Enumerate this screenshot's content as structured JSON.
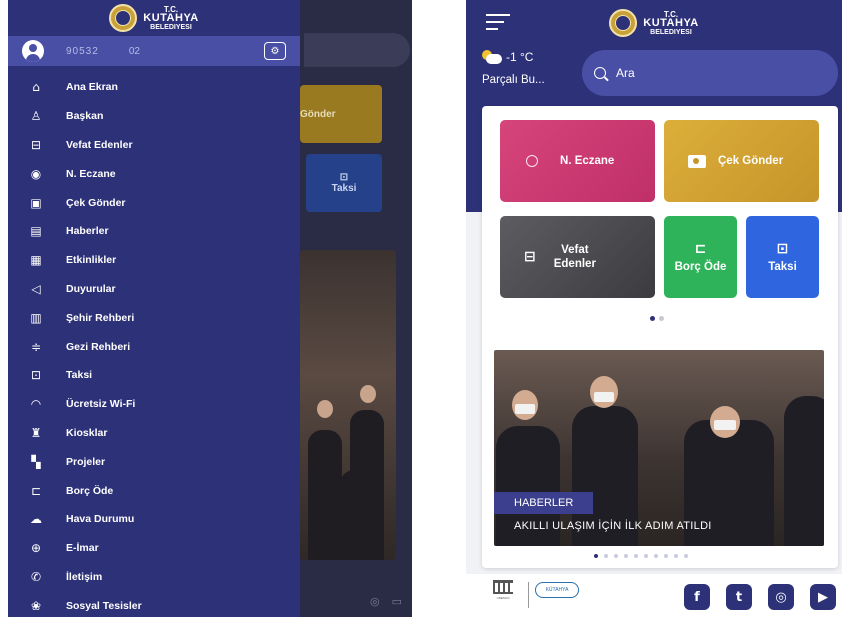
{
  "left_screen": {
    "logo": {
      "tc": "T.C.",
      "name": "KUTAHYA",
      "sub": "BELEDIYESI"
    },
    "user": {
      "phone": "90532",
      "ext": "02"
    },
    "background": {
      "gold_tile": "Gönder",
      "taksi_tile": "Taksi"
    },
    "menu": [
      {
        "label": "Ana Ekran",
        "icon": "home-icon",
        "glyph": "⌂"
      },
      {
        "label": "Başkan",
        "icon": "mayor-icon",
        "glyph": "♙"
      },
      {
        "label": "Vefat Edenler",
        "icon": "memorial-icon",
        "glyph": "⊟"
      },
      {
        "label": "N. Eczane",
        "icon": "pharmacy-icon",
        "glyph": "◉"
      },
      {
        "label": "Çek Gönder",
        "icon": "camera-icon",
        "glyph": "▣"
      },
      {
        "label": "Haberler",
        "icon": "news-icon",
        "glyph": "▤"
      },
      {
        "label": "Etkinlikler",
        "icon": "calendar-icon",
        "glyph": "▦"
      },
      {
        "label": "Duyurular",
        "icon": "megaphone-icon",
        "glyph": "◁"
      },
      {
        "label": "Şehir Rehberi",
        "icon": "city-icon",
        "glyph": "▥"
      },
      {
        "label": "Gezi Rehberi",
        "icon": "signpost-icon",
        "glyph": "≑"
      },
      {
        "label": "Taksi",
        "icon": "taxi-icon",
        "glyph": "⊡"
      },
      {
        "label": "Ücretsiz Wi-Fi",
        "icon": "wifi-icon",
        "glyph": "◠"
      },
      {
        "label": "Kiosklar",
        "icon": "kiosk-icon",
        "glyph": "♜"
      },
      {
        "label": "Projeler",
        "icon": "project-icon",
        "glyph": "▚"
      },
      {
        "label": "Borç Öde",
        "icon": "payment-icon",
        "glyph": "⊏"
      },
      {
        "label": "Hava Durumu",
        "icon": "weather-icon",
        "glyph": "☁"
      },
      {
        "label": "E-İmar",
        "icon": "globe-icon",
        "glyph": "⊕"
      },
      {
        "label": "İletişim",
        "icon": "contact-icon",
        "glyph": "✆"
      },
      {
        "label": "Sosyal Tesisler",
        "icon": "facility-icon",
        "glyph": "❀"
      }
    ]
  },
  "right_screen": {
    "logo": {
      "tc": "T.C.",
      "name": "KUTAHYA",
      "sub": "BELEDIYESI"
    },
    "weather": {
      "temp": "-1 °C",
      "desc": "Parçalı Bu..."
    },
    "search": {
      "placeholder": "Ara"
    },
    "tiles": {
      "eczane": "N. Eczane",
      "cek": "Çek Gönder",
      "vefat_line1": "Vefat",
      "vefat_line2": "Edenler",
      "borc": "Borç Öde",
      "taksi": "Taksi"
    },
    "news": {
      "badge": "HABERLER",
      "title": "AKILLI ULAŞIM İÇİN İLK ADIM ATILDI"
    },
    "footer": {
      "kutahya_badge": "KÜTAHYA",
      "social": [
        "f",
        "t",
        "◎",
        "▶"
      ]
    }
  },
  "colors": {
    "primary": "#2d3178",
    "drawer": "#2d3178",
    "user_row": "#4a4fa6",
    "eczane": "#d6457a",
    "cek_gonder": "#dcae3a",
    "vefat": "#4a4a4e",
    "borc_ode": "#2fb35a",
    "taksi": "#2f66e0"
  }
}
